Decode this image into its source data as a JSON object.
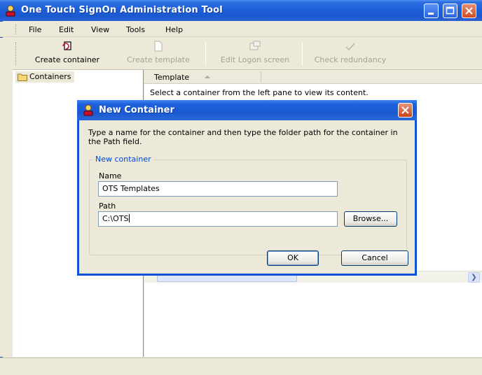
{
  "window": {
    "title": "One Touch SignOn Administration Tool"
  },
  "menu": [
    "File",
    "Edit",
    "View",
    "Tools",
    "Help"
  ],
  "toolbar": {
    "create_container": "Create container",
    "create_template": "Create template",
    "edit_logon_screen": "Edit Logon screen",
    "check_redundancy": "Check redundancy"
  },
  "tree": {
    "root": "Containers"
  },
  "list": {
    "column": "Template",
    "message": "Select a container from the left pane to view its content."
  },
  "dialog": {
    "title": "New Container",
    "description": "Type a name for the container and then type the folder path for the container in the Path field.",
    "group_label": "New container",
    "name_label": "Name",
    "name_value": "OTS Templates",
    "path_label": "Path",
    "path_value": "C:\\OTS",
    "browse": "Browse...",
    "ok": "OK",
    "cancel": "Cancel"
  },
  "colors": {
    "title_blue": "#1d5fd8",
    "face": "#ece9d8",
    "group_label": "#0046d5"
  }
}
